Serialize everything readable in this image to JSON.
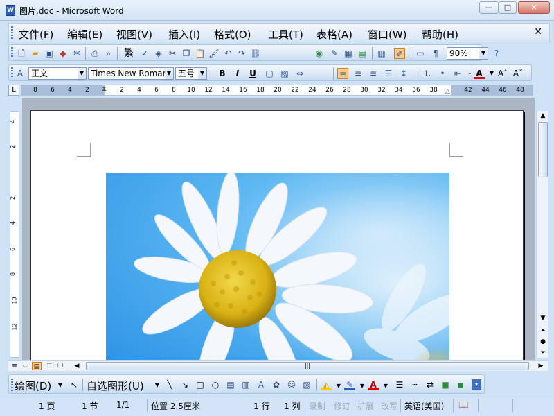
{
  "window": {
    "title": "图片.doc - Microsoft Word",
    "app_icon": "W",
    "controls": {
      "minimize": "—",
      "maximize": "□",
      "close": "✕"
    }
  },
  "menubar": {
    "items": [
      "文件(F)",
      "编辑(E)",
      "视图(V)",
      "插入(I)",
      "格式(O)",
      "工具(T)",
      "表格(A)",
      "窗口(W)",
      "帮助(H)"
    ],
    "close_doc": "✕"
  },
  "standard_toolbar": {
    "traditional_btn": "繁",
    "zoom": "90%"
  },
  "format_toolbar": {
    "style": "正文",
    "font": "Times New Roman",
    "size": "五号",
    "bold": "B",
    "italic": "I",
    "underline": "U",
    "font_color_label": "A"
  },
  "ruler": {
    "labels": [
      "8",
      "6",
      "4",
      "2",
      "2",
      "4",
      "6",
      "8",
      "10",
      "12",
      "14",
      "16",
      "18",
      "20",
      "22",
      "24",
      "26",
      "28",
      "30",
      "32",
      "34",
      "36",
      "38",
      "42",
      "44",
      "46",
      "48"
    ],
    "tab_selector": "L",
    "vertical_labels": [
      "4",
      "2",
      "2",
      "4",
      "6",
      "8",
      "10",
      "12"
    ]
  },
  "drawing_toolbar": {
    "draw": "绘图(D)",
    "autoshapes": "自选图形(U)",
    "font_color_label": "A"
  },
  "hscroll": {
    "thumb_grip": "|||"
  },
  "statusbar": {
    "page": "1 页",
    "section": "1 节",
    "page_of": "1/1",
    "position": "位置 2.5厘米",
    "line": "1 行",
    "column": "1 列",
    "rec": "录制",
    "trk": "修订",
    "ext": "扩展",
    "ovr": "改写",
    "language": "英语(美国)"
  },
  "colors": {
    "picture_sky": "#2b91e6",
    "petal": "#f4f8fc",
    "flower_center": "#e6c21a",
    "toolbar_active": "#ffc98a"
  }
}
